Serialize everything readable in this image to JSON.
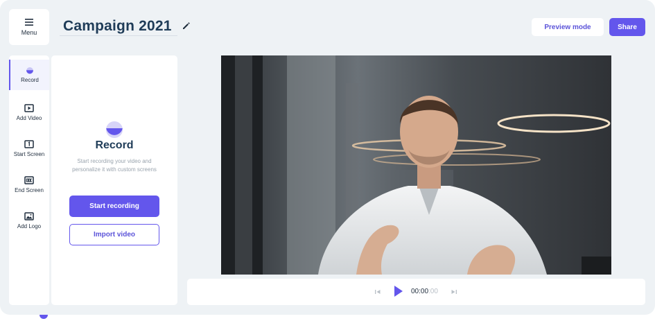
{
  "header": {
    "menu_label": "Menu",
    "title": "Campaign 2021",
    "preview_label": "Preview mode",
    "share_label": "Share"
  },
  "sidebar": {
    "items": [
      {
        "label": "Record",
        "icon": "record-icon",
        "active": true
      },
      {
        "label": "Add Video",
        "icon": "video-play-icon",
        "active": false
      },
      {
        "label": "Start Screen",
        "icon": "start-screen-icon",
        "active": false
      },
      {
        "label": "End Screen",
        "icon": "end-screen-icon",
        "active": false
      },
      {
        "label": "Add Logo",
        "icon": "image-icon",
        "active": false
      }
    ]
  },
  "panel": {
    "title": "Record",
    "description": "Start recording your video and personalize it with custom screens",
    "primary_button": "Start recording",
    "secondary_button": "Import video"
  },
  "player": {
    "time_current": "00:00",
    "time_fraction": ":00"
  },
  "colors": {
    "accent": "#6356ec",
    "background": "#eef2f5",
    "title": "#1f3c58"
  }
}
